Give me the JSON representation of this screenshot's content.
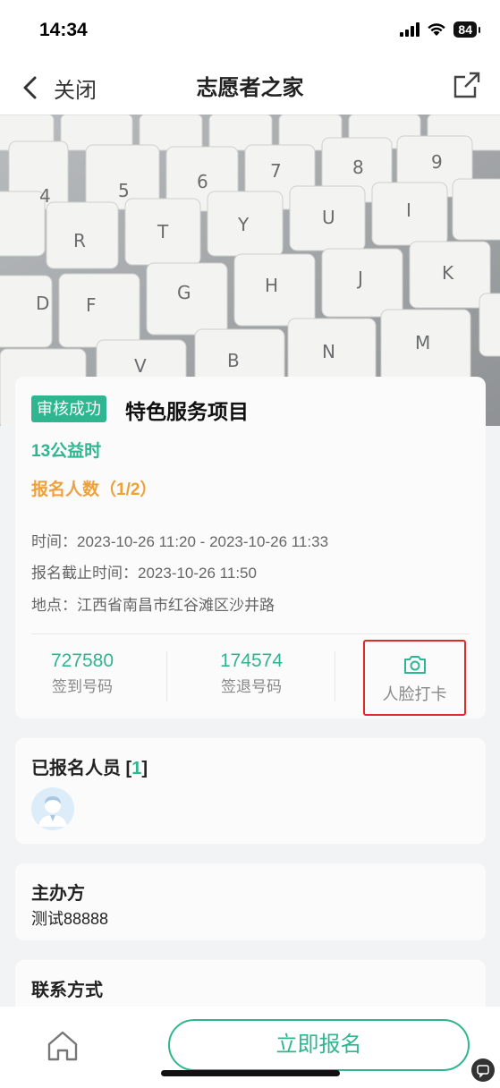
{
  "status_bar": {
    "time": "14:34",
    "battery": "84",
    "signal_icon": "signal-icon",
    "wifi_icon": "wifi-icon"
  },
  "nav": {
    "close_label": "关闭",
    "title": "志愿者之家",
    "back_icon": "chevron-left-icon",
    "share_icon": "share-icon"
  },
  "project": {
    "status_badge": "审核成功",
    "title": "特色服务项目",
    "hours": "13公益时",
    "enroll_count": "报名人数（1/2）",
    "time_label": "时间：",
    "time_value": "2023-10-26 11:20 - 2023-10-26 11:33",
    "deadline_label": "报名截止时间：",
    "deadline_value": "2023-10-26 11:50",
    "location_label": "地点：",
    "location_value": "江西省南昌市红谷滩区沙井路"
  },
  "codes": {
    "checkin_code": "727580",
    "checkin_label": "签到号码",
    "checkout_code": "174574",
    "checkout_label": "签退号码",
    "face_label": "人脸打卡",
    "face_icon": "camera-icon"
  },
  "participants": {
    "title": "已报名人员",
    "count": "1"
  },
  "organizer": {
    "title": "主办方",
    "name": "测试88888"
  },
  "contact": {
    "title": "联系方式"
  },
  "bottom": {
    "enroll_button": "立即报名",
    "home_icon": "home-icon"
  },
  "colors": {
    "accent": "#2fb590",
    "orange": "#eea03a",
    "highlight_border": "#e02a2a"
  }
}
